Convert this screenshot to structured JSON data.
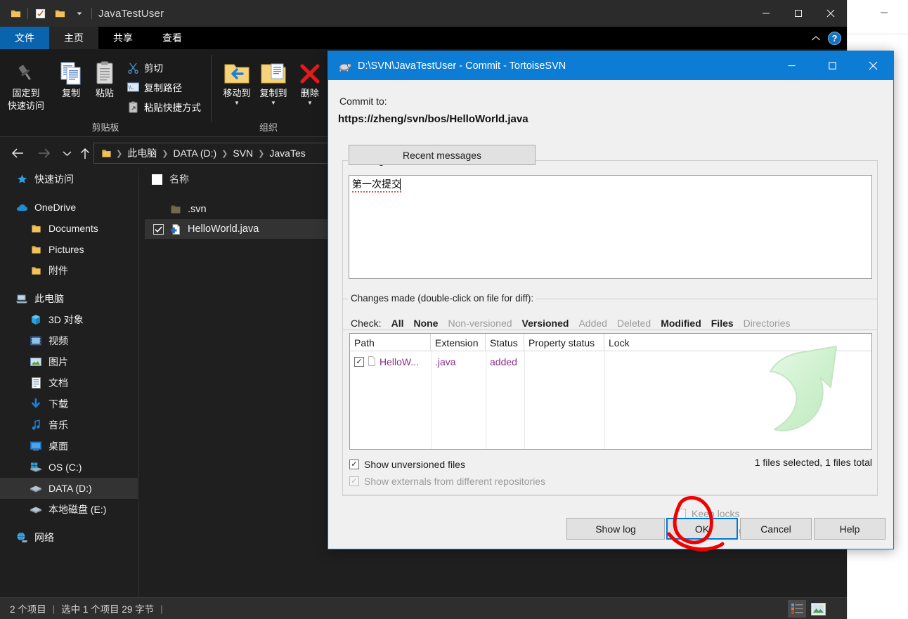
{
  "explorer": {
    "title": "JavaTestUser",
    "quick_access_icons": [
      "folder-icon",
      "properties-icon",
      "new-folder-icon",
      "chevron-down-icon"
    ],
    "window_controls": [
      "minimize-icon",
      "maximize-icon",
      "close-icon"
    ],
    "tabs": [
      {
        "label": "文件",
        "state": "file-menu"
      },
      {
        "label": "主页",
        "state": "active"
      },
      {
        "label": "共享",
        "state": "normal"
      },
      {
        "label": "查看",
        "state": "normal"
      }
    ],
    "ribbon": {
      "collapse_icon": "chevron-up-icon",
      "help_icon": "help-icon",
      "groups": [
        {
          "name": "剪贴板",
          "big_buttons": [
            {
              "label_line1": "固定到",
              "label_line2": "快速访问",
              "icon": "pin-icon"
            },
            {
              "label_line1": "复制",
              "label_line2": "",
              "icon": "copy-icon"
            },
            {
              "label_line1": "粘贴",
              "label_line2": "",
              "icon": "paste-icon"
            }
          ],
          "small_buttons": [
            {
              "label": "剪切",
              "icon": "scissors-icon"
            },
            {
              "label": "复制路径",
              "icon": "copy-path-icon"
            },
            {
              "label": "粘贴快捷方式",
              "icon": "paste-shortcut-icon"
            }
          ]
        },
        {
          "name": "组织",
          "big_buttons": [
            {
              "label_line1": "移动到",
              "label_line2": "",
              "icon": "move-to-icon",
              "has_caret": true
            },
            {
              "label_line1": "复制到",
              "label_line2": "",
              "icon": "copy-to-icon",
              "has_caret": true
            },
            {
              "label_line1": "删除",
              "label_line2": "",
              "icon": "delete-icon",
              "has_caret": true
            }
          ],
          "small_buttons": []
        }
      ]
    },
    "nav": {
      "back_icon": "arrow-left-icon",
      "forward_icon": "arrow-right-icon",
      "recent_icon": "chevron-down-icon",
      "up_icon": "arrow-up-icon"
    },
    "breadcrumb": {
      "icon": "folder-icon",
      "parts": [
        "此电脑",
        "DATA (D:)",
        "SVN",
        "JavaTes"
      ]
    },
    "sidebar": [
      {
        "label": "快速访问",
        "icon": "star-icon",
        "indent": 0,
        "selected": false
      },
      {
        "label": "",
        "icon": "",
        "indent": 0,
        "selected": false,
        "gap": true
      },
      {
        "label": "OneDrive",
        "icon": "cloud-icon",
        "indent": 0,
        "selected": false
      },
      {
        "label": "Documents",
        "icon": "folder-icon",
        "indent": 1,
        "selected": false
      },
      {
        "label": "Pictures",
        "icon": "folder-icon",
        "indent": 1,
        "selected": false
      },
      {
        "label": "附件",
        "icon": "folder-icon",
        "indent": 1,
        "selected": false
      },
      {
        "label": "",
        "icon": "",
        "indent": 0,
        "selected": false,
        "gap": true
      },
      {
        "label": "此电脑",
        "icon": "this-pc-icon",
        "indent": 0,
        "selected": false
      },
      {
        "label": "3D 对象",
        "icon": "3d-objects-icon",
        "indent": 1,
        "selected": false
      },
      {
        "label": "视频",
        "icon": "videos-icon",
        "indent": 1,
        "selected": false
      },
      {
        "label": "图片",
        "icon": "pictures-icon",
        "indent": 1,
        "selected": false
      },
      {
        "label": "文档",
        "icon": "documents-icon",
        "indent": 1,
        "selected": false
      },
      {
        "label": "下载",
        "icon": "downloads-icon",
        "indent": 1,
        "selected": false
      },
      {
        "label": "音乐",
        "icon": "music-icon",
        "indent": 1,
        "selected": false
      },
      {
        "label": "桌面",
        "icon": "desktop-icon",
        "indent": 1,
        "selected": false
      },
      {
        "label": "OS (C:)",
        "icon": "windows-drive-icon",
        "indent": 1,
        "selected": false
      },
      {
        "label": "DATA (D:)",
        "icon": "drive-icon",
        "indent": 1,
        "selected": true
      },
      {
        "label": "本地磁盘 (E:)",
        "icon": "drive-icon",
        "indent": 1,
        "selected": false
      },
      {
        "label": "",
        "icon": "",
        "indent": 0,
        "selected": false,
        "gap": true
      },
      {
        "label": "网络",
        "icon": "network-icon",
        "indent": 0,
        "selected": false
      }
    ],
    "file_list": {
      "column_header": "名称",
      "sort_indicator": "chevron-up-icon",
      "rows": [
        {
          "name": ".svn",
          "icon": "folder-dim-icon",
          "checked": false,
          "selected": false
        },
        {
          "name": "HelloWorld.java",
          "icon": "java-file-added-icon",
          "checked": true,
          "selected": true
        }
      ]
    },
    "status": {
      "items_text": "2 个项目",
      "selection_text": "选中 1 个项目  29 字节",
      "view_details_icon": "details-view-icon",
      "view_thumbnails_icon": "thumbnails-view-icon"
    }
  },
  "dialog": {
    "title": "D:\\SVN\\JavaTestUser - Commit - TortoiseSVN",
    "icon": "tortoise-icon",
    "window_controls": [
      "minimize-icon",
      "maximize-icon",
      "close-icon"
    ],
    "commit_to_label": "Commit to:",
    "commit_url": "https://zheng/svn/bos/HelloWorld.java",
    "message_group_label": "Message:",
    "recent_messages_button": "Recent messages",
    "message_value": "第一次提交",
    "changes_group_label": "Changes made (double-click on file for diff):",
    "check_label": "Check:",
    "check_links": [
      {
        "label": "All",
        "style": "bold"
      },
      {
        "label": "None",
        "style": "bold"
      },
      {
        "label": "Non-versioned",
        "style": "dim"
      },
      {
        "label": "Versioned",
        "style": "bold"
      },
      {
        "label": "Added",
        "style": "dim"
      },
      {
        "label": "Deleted",
        "style": "dim"
      },
      {
        "label": "Modified",
        "style": "bold"
      },
      {
        "label": "Files",
        "style": "bold"
      },
      {
        "label": "Directories",
        "style": "dim"
      }
    ],
    "table": {
      "columns": [
        "Path",
        "Extension",
        "Status",
        "Property status",
        "Lock"
      ],
      "rows": [
        {
          "checked": true,
          "path": "HelloW...",
          "extension": ".java",
          "status": "added",
          "property_status": "",
          "lock": ""
        }
      ],
      "watermark_icon": "commit-arrow-watermark"
    },
    "show_unversioned_label": "Show unversioned files",
    "show_unversioned_checked": true,
    "show_externals_label": "Show externals from different repositories",
    "show_externals_checked": true,
    "show_externals_disabled": true,
    "files_summary": "1 files selected, 1 files total",
    "keep_locks_label": "Keep locks",
    "keep_changelists_label": "Keep changelists",
    "buttons": [
      {
        "label": "Show log",
        "focused": false
      },
      {
        "label": "OK",
        "focused": true
      },
      {
        "label": "Cancel",
        "focused": false
      },
      {
        "label": "Help",
        "focused": false
      }
    ],
    "annotation": {
      "shape": "red-circle-annotation",
      "color": "#f00000",
      "target": "OK"
    }
  },
  "colors": {
    "explorer_bg": "#1f1f1f",
    "title_bar": "#2b2b2b",
    "file_tab": "#0a64ad",
    "dialog_title": "#0c7cd5",
    "focus_border": "#0078d7",
    "link_purple": "#8a2f8a",
    "annotation_red": "#f00000",
    "watermark_green": "#cdf0cd"
  }
}
